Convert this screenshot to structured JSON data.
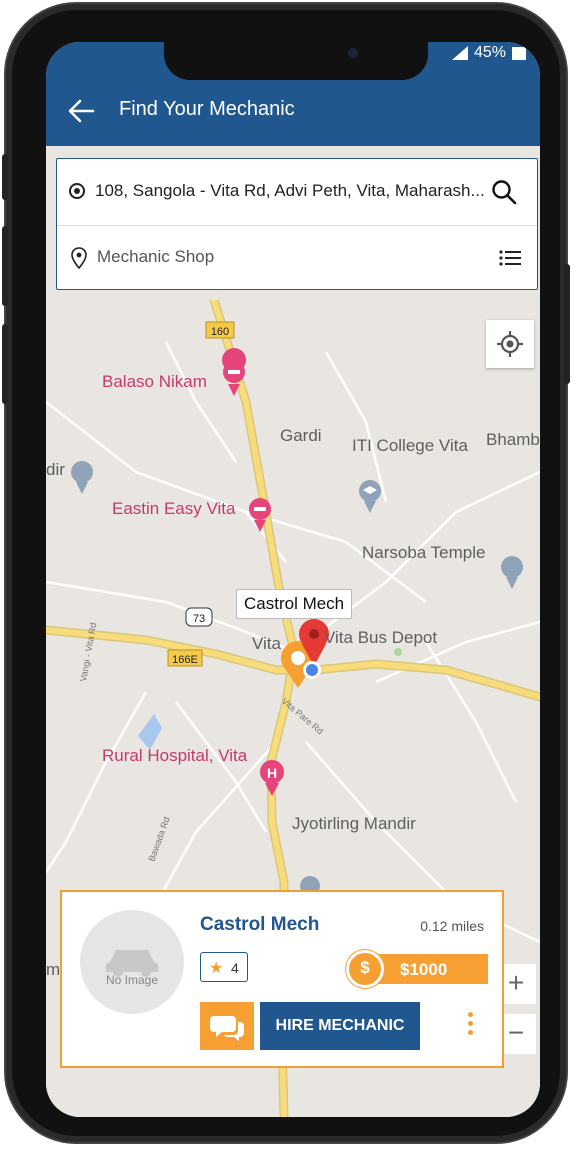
{
  "status": {
    "battery": "45%"
  },
  "header": {
    "title": "Find Your Mechanic"
  },
  "search": {
    "address": "108, Sangola - Vita Rd, Advi Peth, Vita, Maharash...",
    "category": "Mechanic Shop"
  },
  "map": {
    "labels": {
      "balaso": "Balaso Nikam",
      "gardi": "Gardi",
      "iti": "ITI College Vita",
      "bhamb": "Bhamb",
      "dir": "dir",
      "eastin": "Eastin Easy Vita",
      "narsoba": "Narsoba Temple",
      "vita": "Vita",
      "busdepot": "Vita Bus Depot",
      "rural": "Rural Hospital, Vita",
      "jyotirling": "Jyotirling Mandir",
      "mp": "mp"
    },
    "shields": {
      "r160": "160",
      "r73": "73",
      "r166e": "166E"
    },
    "roads": {
      "vangi": "Vangi - Vita Rd",
      "vitapare": "Vita Pare Rd",
      "bawada": "Bawada Rd"
    },
    "callout": "Castrol Mech",
    "zoom_in": "+",
    "zoom_out": "−"
  },
  "card": {
    "name": "Castrol Mech",
    "distance": "0.12 miles",
    "rating": "4",
    "price": "$1000",
    "currency_symbol": "$",
    "no_image": "No Image",
    "hire_label": "HIRE MECHANIC"
  },
  "colors": {
    "primary": "#20578e",
    "accent": "#f6a033",
    "pink_poi": "#c43b6b"
  }
}
